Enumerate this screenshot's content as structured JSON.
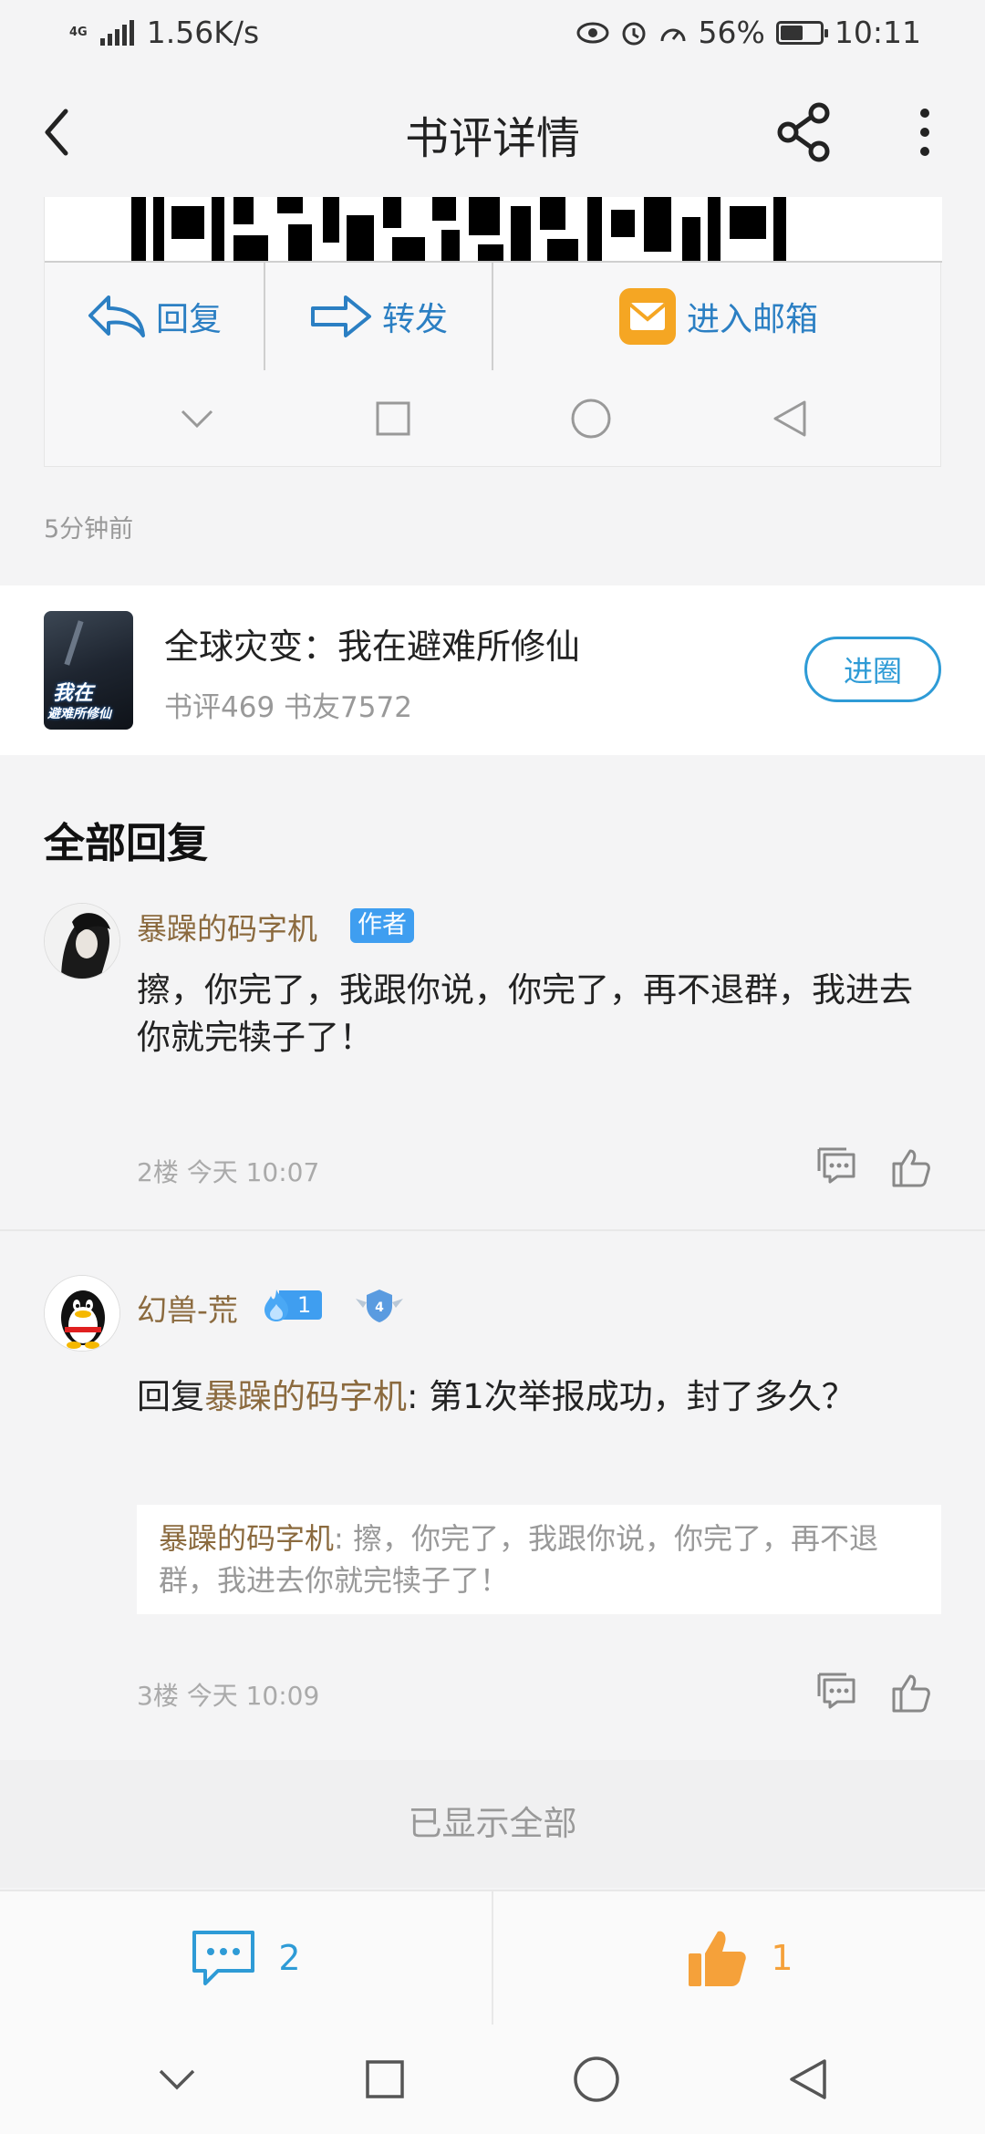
{
  "status_bar": {
    "network": "4G",
    "speed": "1.56K/s",
    "battery": "56%",
    "battery_level": 0.56,
    "time": "10:11"
  },
  "header": {
    "title": "书评详情"
  },
  "email_card": {
    "reply_label": "回复",
    "forward_label": "转发",
    "mailbox_label": "进入邮箱"
  },
  "post": {
    "time_ago": "5分钟前"
  },
  "book": {
    "title": "全球灾变：我在避难所修仙",
    "meta": "书评469 书友7572",
    "join_label": "进圈",
    "cover_text_1": "我在",
    "cover_text_2": "避难所修仙"
  },
  "replies_section": {
    "title": "全部回复",
    "items": [
      {
        "username": "暴躁的码字机",
        "tag": "作者",
        "content": "擦，你完了，我跟你说，你完了，再不退群，我进去你就完犊子了！",
        "meta": "2楼 今天 10:07"
      },
      {
        "username": "幻兽-荒",
        "level": "1",
        "badge": "4",
        "reply_prefix": "回复",
        "reply_to": "暴躁的码字机",
        "content": ": 第1次举报成功，封了多久？",
        "quote_user": "暴躁的码字机",
        "quote_text": ": 擦，你完了，我跟你说，你完了，再不退群，我进去你就完犊子了！",
        "meta": "3楼 今天 10:09"
      }
    ],
    "all_shown": "已显示全部"
  },
  "bottom_bar": {
    "comment_count": "2",
    "like_count": "1"
  },
  "colors": {
    "accent_blue": "#2e9bd6",
    "username_brown": "#8b6a3e",
    "like_orange": "#f5a13a"
  }
}
